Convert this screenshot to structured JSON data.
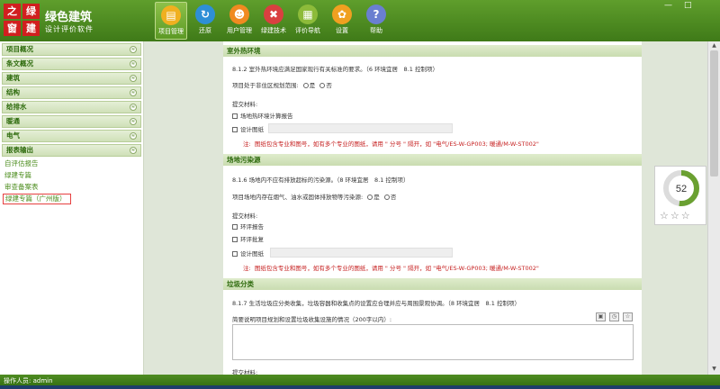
{
  "app": {
    "logo_chars": [
      "之",
      "绿",
      "窗",
      "建"
    ],
    "title": "绿色建筑",
    "subtitle": "设计评价软件",
    "window_controls": [
      "—",
      "□"
    ]
  },
  "toolbar": [
    {
      "label": "项目管理",
      "icon": "document-icon",
      "active": true,
      "color": "#f0b020",
      "glyph": "▤"
    },
    {
      "label": "还原",
      "icon": "refresh-icon",
      "active": false,
      "color": "#2e8fd6",
      "glyph": "↻"
    },
    {
      "label": "用户管理",
      "icon": "user-icon",
      "active": false,
      "color": "#f08a20",
      "glyph": "☻"
    },
    {
      "label": "绿建技术",
      "icon": "tech-icon",
      "active": false,
      "color": "#d94040",
      "glyph": "✖"
    },
    {
      "label": "评价导航",
      "icon": "nav-icon",
      "active": false,
      "color": "#8dbb3a",
      "glyph": "▦"
    },
    {
      "label": "设置",
      "icon": "gear-icon",
      "active": false,
      "color": "#f0a020",
      "glyph": "✿"
    },
    {
      "label": "帮助",
      "icon": "help-icon",
      "active": false,
      "color": "#6a7fd0",
      "glyph": "?"
    }
  ],
  "sidebar": {
    "heads": [
      "项目概况",
      "条文概况",
      "建筑",
      "结构",
      "给排水",
      "暖通",
      "电气",
      "报表输出"
    ],
    "subs": [
      "自评估报告",
      "绿建专篇",
      "审查备案表",
      "绿建专篇（广州版）"
    ],
    "chevron": "≈"
  },
  "sections": {
    "s1": {
      "title": "室外热环境",
      "clause": "8.1.2 室外热环境应满足国家现行有关标准的要求。（6 环境宜居　8.1 控制项）",
      "question": "项目处于非住区规划范围:",
      "radio_yes": "是",
      "radio_no": "否",
      "materials_label": "提交材料:",
      "items": [
        "场地热环境计算报告",
        "设计图纸"
      ],
      "note_label": "注:",
      "note": "图纸包含专业和图号，如有多个专业的图纸，请用 \" 分号 \" 隔开，如 \"电气/ES-W-GP003; 暖通/M-W-ST002\""
    },
    "s2": {
      "title": "场地污染源",
      "clause": "8.1.6 场地内不应有排放超标的污染源。（8 环境宜居　8.1 控制项）",
      "question": "项目场地内存在烟气、油水或固体排放物等污染源:",
      "radio_yes": "是",
      "radio_no": "否",
      "materials_label": "提交材料:",
      "items": [
        "环评报告",
        "环评批复",
        "设计图纸"
      ],
      "note_label": "注:",
      "note": "图纸包含专业和图号，如有多个专业的图纸，请用 \" 分号 \" 隔开，如 \"电气/ES-W-GP003; 暖通/M-W-ST002\""
    },
    "s3": {
      "title": "垃圾分类",
      "clause": "8.1.7 生活垃圾应分类收集，垃圾容器和收集点的设置应合理并应与周围景观协调。（8 环境宜居　8.1 控制项）",
      "textarea_label": "简要说明项目规划和设置垃圾收集设施的情况（200字以内）:",
      "materials_label": "提交材料:"
    }
  },
  "score": {
    "value": "52",
    "fraction": 0.52,
    "color": "#6aa031",
    "stars": "☆☆☆"
  },
  "status": {
    "operator_label": "操作人员:",
    "operator": "admin"
  }
}
